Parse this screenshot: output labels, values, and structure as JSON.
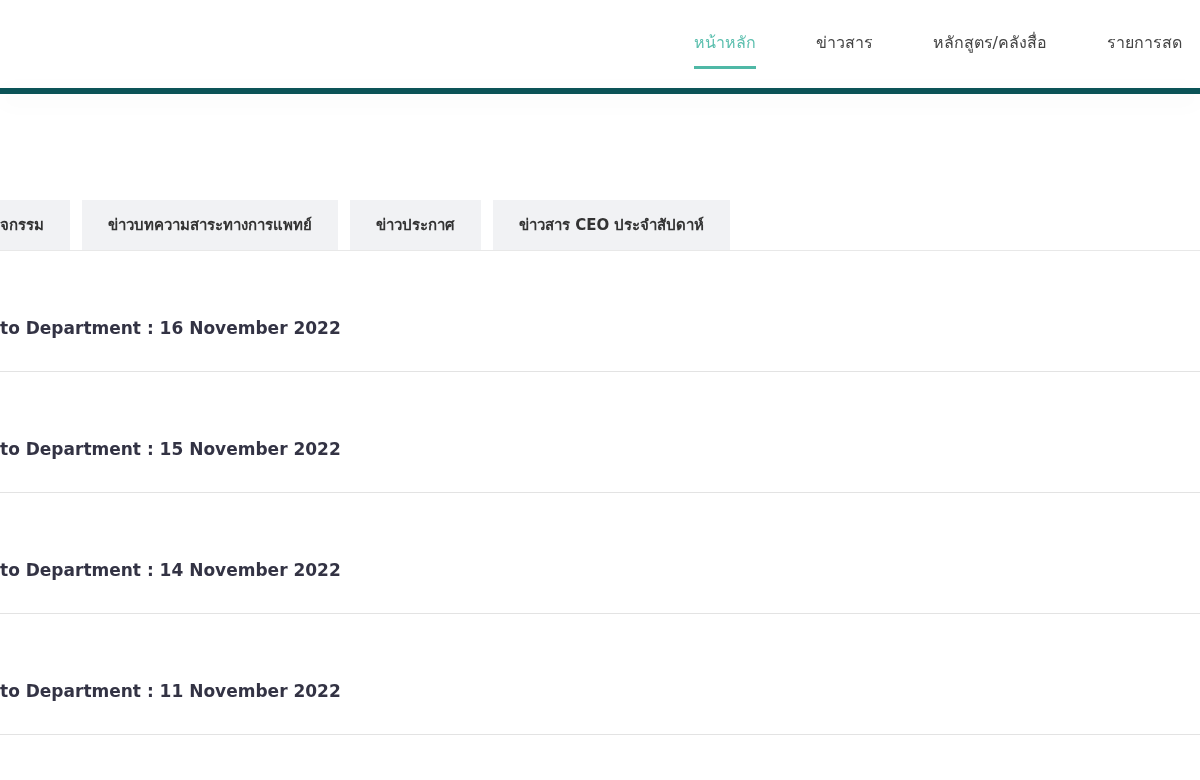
{
  "nav": [
    {
      "label": "หน้าหลัก",
      "selected": true
    },
    {
      "label": "ข่าวสาร",
      "selected": false
    },
    {
      "label": "หลักสูตร/คลังสื่อ",
      "selected": false
    },
    {
      "label": "รายการสด",
      "selected": false
    }
  ],
  "tabs": [
    {
      "label": "จกรรม",
      "selected": false
    },
    {
      "label": "ข่าวบทความสาระทางการแพทย์",
      "selected": false
    },
    {
      "label": "ข่าวประกาศ",
      "selected": false
    },
    {
      "label": "ข่าวสาร CEO ประจำสัปดาห์",
      "selected": false
    }
  ],
  "news": [
    {
      "title": "to Department : 16 November 2022"
    },
    {
      "title": "to Department : 15 November 2022"
    },
    {
      "title": "to Department : 14 November 2022"
    },
    {
      "title": "to Department : 11 November 2022"
    }
  ]
}
